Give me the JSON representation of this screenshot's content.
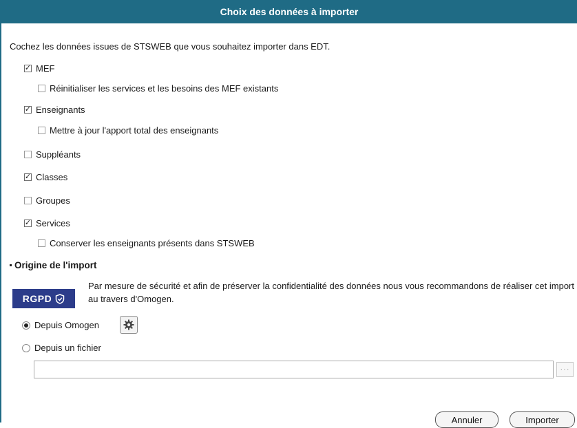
{
  "dialog": {
    "title": "Choix des données à importer",
    "intro": "Cochez les données issues de STSWEB que vous souhaitez importer dans EDT."
  },
  "options": [
    {
      "label": "MEF",
      "checked": true
    },
    {
      "label": "Réinitialiser les services et les besoins des MEF existants",
      "checked": false
    },
    {
      "label": "Enseignants",
      "checked": true
    },
    {
      "label": "Mettre à jour l'apport total des enseignants",
      "checked": false
    },
    {
      "label": "Suppléants",
      "checked": false
    },
    {
      "label": "Classes",
      "checked": true
    },
    {
      "label": "Groupes",
      "checked": false
    },
    {
      "label": "Services",
      "checked": true
    },
    {
      "label": "Conserver les enseignants présents dans STSWEB",
      "checked": false
    }
  ],
  "origin": {
    "section_title": "Origine de l'import",
    "rgpd_badge": "RGPD",
    "rgpd_text": "Par mesure de sécurité et afin de préserver la confidentialité des données nous vous recommandons de réaliser cet import au travers d'Omogen.",
    "radio_omogen": "Depuis Omogen",
    "radio_file": "Depuis un fichier",
    "selected": "omogen",
    "file_value": "",
    "browse_label": "···"
  },
  "buttons": {
    "cancel": "Annuler",
    "import": "Importer"
  },
  "colors": {
    "title_bar": "#1f6b85",
    "rgpd_badge": "#2c3c8a"
  }
}
